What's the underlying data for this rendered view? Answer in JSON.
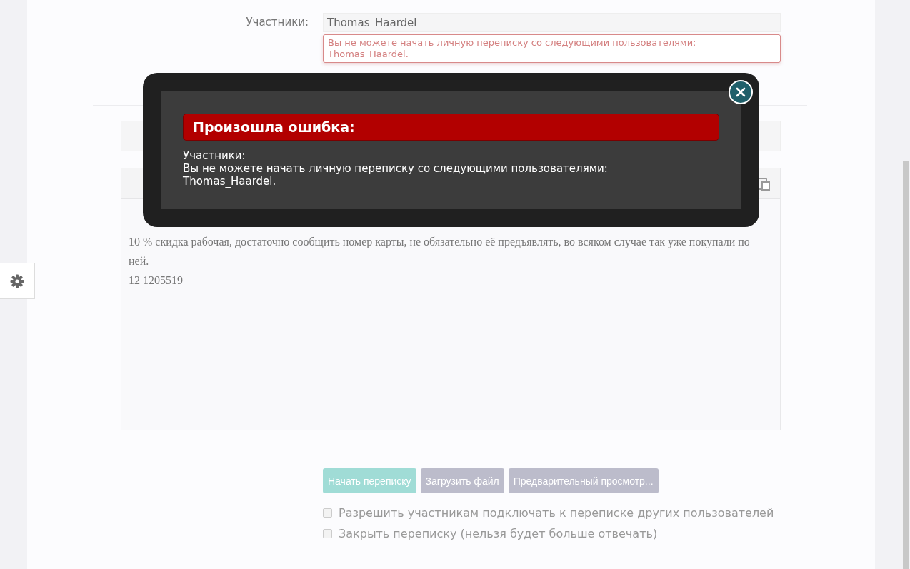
{
  "participants": {
    "label": "Участники:",
    "value": "Thomas_Haardel",
    "error": "Вы не можете начать личную переписку со следующими пользователями: Thomas_Haardel."
  },
  "message": {
    "lines": [
      "10 % скидка рабочая, достаточно сообщить номер карты, не обязательно её предъявлять, во всяком случае так уже покупали по ней.",
      "12 1205519"
    ]
  },
  "buttons": [
    {
      "label": "Начать переписку",
      "kind": "primary"
    },
    {
      "label": "Загрузить файл",
      "kind": "secondary"
    },
    {
      "label": "Предварительный просмотр...",
      "kind": "secondary"
    }
  ],
  "options": [
    {
      "label": "Разрешить участникам подключать к переписке других пользователей",
      "checked": false
    },
    {
      "label": "Закрыть переписку (нельзя будет больше отвечать)",
      "checked": false
    }
  ],
  "error_dialog": {
    "title": "Произошла ошибка:",
    "lines": [
      "Участники:",
      "Вы не можете начать личную переписку со следующими пользователями:",
      "Thomas_Haardel."
    ]
  }
}
